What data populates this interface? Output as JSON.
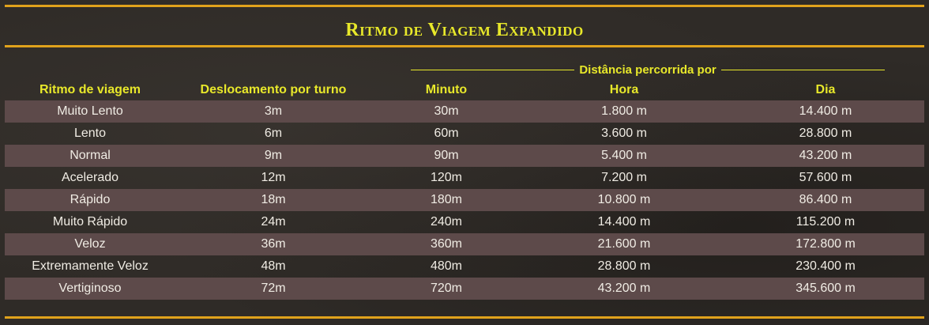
{
  "title": "Ritmo de Viagem Expandido",
  "group_header": "Distância percorrida por",
  "columns": [
    "Ritmo de viagem",
    "Deslocamento por turno",
    "Minuto",
    "Hora",
    "Dia"
  ],
  "rows": [
    [
      "Muito Lento",
      "3m",
      "30m",
      "1.800 m",
      "14.400 m"
    ],
    [
      "Lento",
      "6m",
      "60m",
      "3.600 m",
      "28.800 m"
    ],
    [
      "Normal",
      "9m",
      "90m",
      "5.400 m",
      "43.200 m"
    ],
    [
      "Acelerado",
      "12m",
      "120m",
      "7.200 m",
      "57.600 m"
    ],
    [
      "Rápido",
      "18m",
      "180m",
      "10.800 m",
      "86.400 m"
    ],
    [
      "Muito Rápido",
      "24m",
      "240m",
      "14.400 m",
      "115.200 m"
    ],
    [
      "Veloz",
      "36m",
      "360m",
      "21.600 m",
      "172.800 m"
    ],
    [
      "Extremamente Veloz",
      "48m",
      "480m",
      "28.800 m",
      "230.400 m"
    ],
    [
      "Vertiginoso",
      "72m",
      "720m",
      "43.200 m",
      "345.600 m"
    ]
  ],
  "colors": {
    "background": "#2f2b27",
    "accent_rule": "#e0a21c",
    "header_text": "#e8e82a",
    "row_stripe": "#5d4a4a",
    "cell_text": "#f0ece4"
  }
}
